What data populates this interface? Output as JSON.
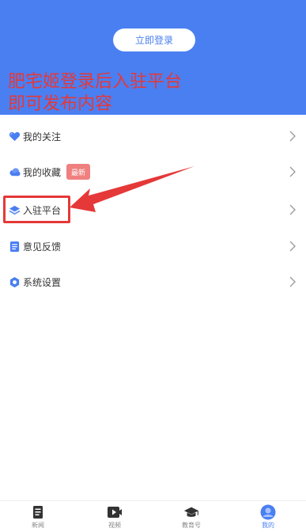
{
  "header": {
    "login_button": "立即登录",
    "bg_color": "#4a7ff2"
  },
  "annotation": {
    "line1": "肥宅姬登录后入驻平台",
    "line2": "即可发布内容",
    "color": "#e53838"
  },
  "menu": {
    "items": [
      {
        "label": "我的关注",
        "icon": "heart-icon"
      },
      {
        "label": "我的收藏",
        "icon": "cloud-icon",
        "badge": "最新"
      },
      {
        "label": "入驻平台",
        "icon": "layers-icon"
      },
      {
        "label": "意见反馈",
        "icon": "document-icon"
      },
      {
        "label": "系统设置",
        "icon": "settings-icon"
      }
    ]
  },
  "tabbar": {
    "tabs": [
      {
        "label": "新闻",
        "icon": "news-icon"
      },
      {
        "label": "视频",
        "icon": "video-icon"
      },
      {
        "label": "教育号",
        "icon": "graduation-cap-icon"
      },
      {
        "label": "我的",
        "icon": "user-icon",
        "active": true
      }
    ]
  }
}
